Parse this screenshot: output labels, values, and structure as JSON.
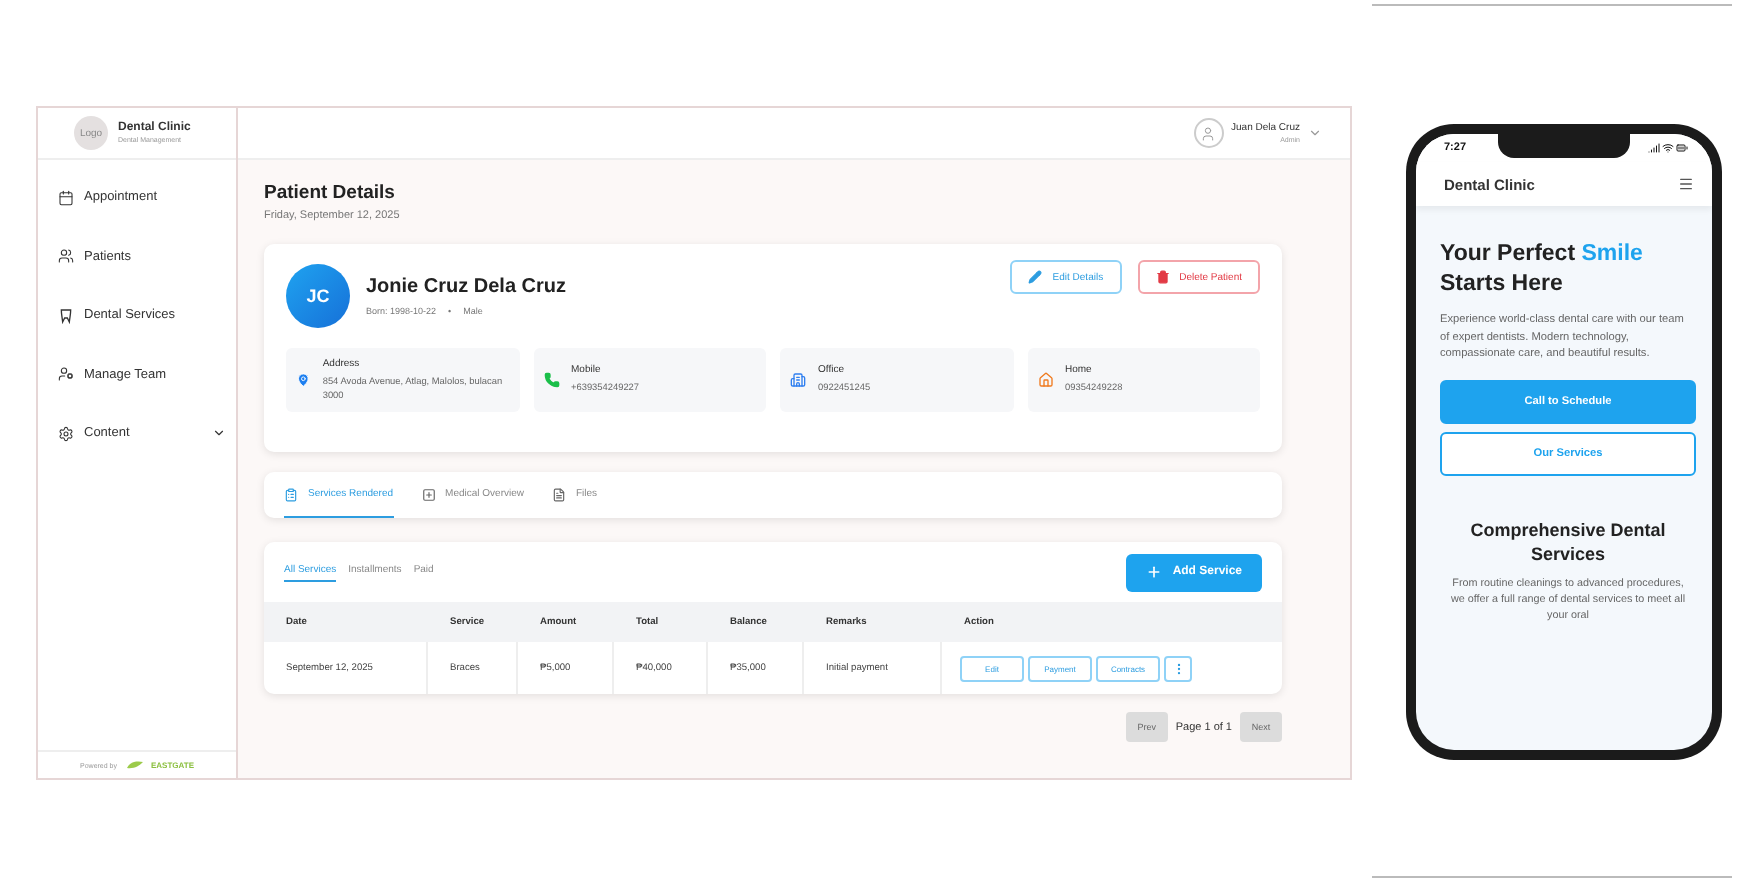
{
  "sidebar": {
    "logo": "Logo",
    "clinic": "Dental Clinic",
    "subtitle": "Dental Management",
    "items": [
      {
        "label": "Appointment",
        "kind": "link"
      },
      {
        "label": "Patients",
        "kind": "link"
      },
      {
        "label": "Dental Services",
        "kind": "link"
      },
      {
        "label": "Manage Team",
        "kind": "link"
      },
      {
        "label": "Content",
        "kind": "group"
      }
    ],
    "powered_by": "Powered by",
    "brand": "EASTGATE"
  },
  "user": {
    "name": "Juan Dela Cruz",
    "role": "Admin"
  },
  "page": {
    "title": "Patient Details",
    "date": "Friday, September 12, 2025"
  },
  "patient": {
    "initials": "JC",
    "name": "Jonie Cruz Dela Cruz",
    "born": "Born: 1998-10-22",
    "separator": "•",
    "sex": "Male",
    "actions": [
      {
        "label": "Edit Details",
        "kind": "edit"
      },
      {
        "label": "Delete Patient",
        "kind": "delete"
      }
    ],
    "contacts": [
      {
        "kind": "address",
        "label": "Address",
        "value": "854 Avoda Avenue, Atlag, Malolos, bulacan 3000"
      },
      {
        "kind": "mobile",
        "label": "Mobile",
        "value": "+639354249227"
      },
      {
        "kind": "office",
        "label": "Office",
        "value": "0922451245"
      },
      {
        "kind": "home",
        "label": "Home",
        "value": "09354249228"
      }
    ]
  },
  "tabs": [
    {
      "label": "Services Rendered",
      "kind": "clipboard",
      "selected": true
    },
    {
      "label": "Medical Overview",
      "kind": "medical",
      "selected": false
    },
    {
      "label": "Files",
      "kind": "file",
      "selected": false
    }
  ],
  "services": {
    "filters": [
      {
        "label": "All Services",
        "selected": true
      },
      {
        "label": "Installments",
        "selected": false
      },
      {
        "label": "Paid",
        "selected": false
      }
    ],
    "add_button": "Add Service",
    "table": {
      "columns": [
        "Date",
        "Service",
        "Amount",
        "Total",
        "Balance",
        "Remarks",
        "Action"
      ],
      "rows": [
        {
          "cells": [
            "September 12, 2025",
            "Braces",
            "₱5,000",
            "₱40,000",
            "₱35,000",
            "Initial payment"
          ],
          "actions": [
            "Edit",
            "Payment",
            "Contracts"
          ]
        }
      ]
    },
    "pagination": {
      "prev": "Prev",
      "page": "Page 1 of 1",
      "next": "Next",
      "prev_disabled": true,
      "next_disabled": true
    }
  },
  "phone": {
    "time": "7:27",
    "brand": "Dental Clinic",
    "headline": [
      {
        "text": "Your Perfect",
        "highlight": false
      },
      {
        "text": "Smile",
        "highlight": true
      },
      {
        "text": "Starts Here",
        "highlight": false
      }
    ],
    "intro": "Experience world-class dental care with our team of expert dentists. Modern technology, compassionate care, and beautiful results.",
    "buttons": [
      {
        "label": "Call to Schedule",
        "kind": "primary"
      },
      {
        "label": "Our Services",
        "kind": "outline"
      }
    ],
    "section_title": "Comprehensive Dental Services",
    "section_text": "From routine cleanings to advanced procedures, we offer a full range of dental services to meet all your oral"
  }
}
